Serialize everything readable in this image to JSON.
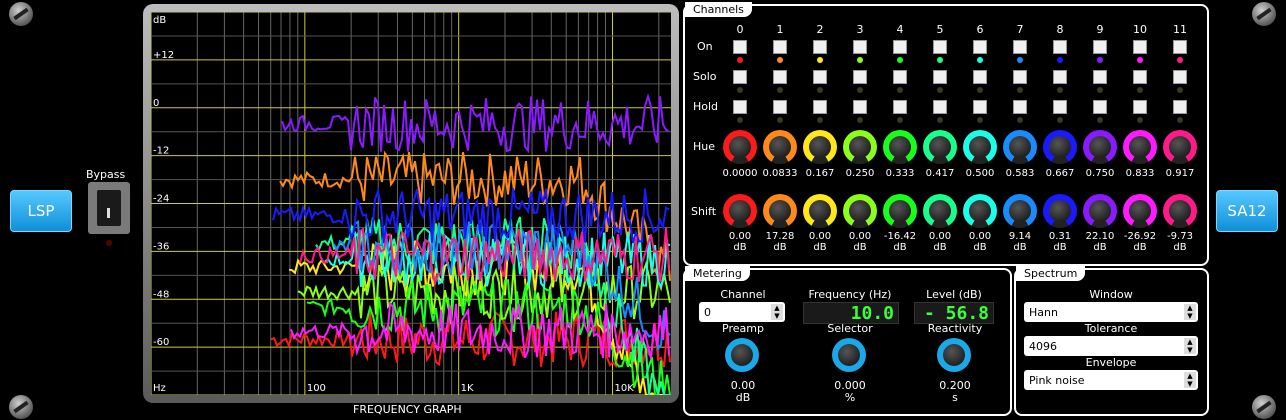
{
  "buttons": {
    "lsp": "LSP",
    "plugin": "SA12"
  },
  "bypass": {
    "label": "Bypass"
  },
  "graph": {
    "title": "FREQUENCY GRAPH",
    "y_unit": "dB",
    "x_unit": "Hz",
    "y_labels": [
      "+12",
      "0",
      "-12",
      "-24",
      "-36",
      "-48",
      "-60"
    ],
    "x_labels": [
      "100",
      "1K",
      "10K"
    ]
  },
  "channels": {
    "title": "Channels",
    "labels": {
      "on": "On",
      "solo": "Solo",
      "hold": "Hold",
      "hue": "Hue",
      "shift": "Shift"
    },
    "numbers": [
      "0",
      "1",
      "2",
      "3",
      "4",
      "5",
      "6",
      "7",
      "8",
      "9",
      "10",
      "11"
    ],
    "colors": [
      "#ff1a1a",
      "#ff8a1a",
      "#ffe81a",
      "#8aff1a",
      "#1aff1a",
      "#1aff8a",
      "#1affe8",
      "#1a8aff",
      "#1a1aff",
      "#8a1aff",
      "#ff1aff",
      "#ff1a8a"
    ],
    "hue_values": [
      "0.0000",
      "0.0833",
      "0.167",
      "0.250",
      "0.333",
      "0.417",
      "0.500",
      "0.583",
      "0.667",
      "0.750",
      "0.833",
      "0.917"
    ],
    "shift_values": [
      "0.00",
      "17.28",
      "0.00",
      "0.00",
      "-16.42",
      "0.00",
      "0.00",
      "9.14",
      "0.31",
      "22.10",
      "-26.92",
      "-9.73"
    ],
    "shift_unit": "dB"
  },
  "metering": {
    "title": "Metering",
    "channel_label": "Channel",
    "channel_value": "0",
    "frequency_label": "Frequency (Hz)",
    "frequency_value": "10.0",
    "level_label": "Level (dB)",
    "level_value": "- 56.8",
    "preamp_label": "Preamp",
    "preamp_value": "0.00",
    "preamp_unit": "dB",
    "selector_label": "Selector",
    "selector_value": "0.000",
    "selector_unit": "%",
    "reactivity_label": "Reactivity",
    "reactivity_value": "0.200",
    "reactivity_unit": "s"
  },
  "spectrum": {
    "title": "Spectrum",
    "window_label": "Window",
    "window_value": "Hann",
    "tolerance_label": "Tolerance",
    "tolerance_value": "4096",
    "envelope_label": "Envelope",
    "envelope_value": "Pink noise"
  }
}
